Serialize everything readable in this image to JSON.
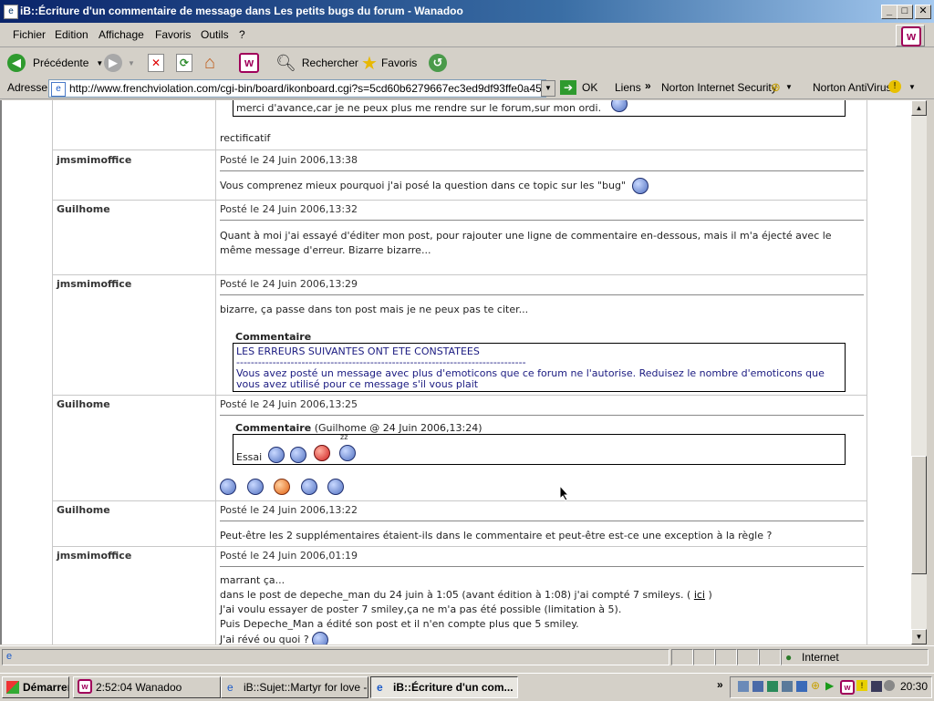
{
  "window": {
    "title": "iB::Écriture d'un commentaire de message dans Les petits bugs du forum - Wanadoo",
    "minimize": "_",
    "maximize": "□",
    "close": "✕"
  },
  "menu": [
    "Fichier",
    "Edition",
    "Affichage",
    "Favoris",
    "Outils",
    "?"
  ],
  "toolbar": {
    "back_label": "Précédente",
    "search_label": "Rechercher",
    "favorites_label": "Favoris"
  },
  "address": {
    "label": "Adresse",
    "url": "http://www.frenchviolation.com/cgi-bin/board/ikonboard.cgi?s=5cd60b6279667ec3ed9df93ffe0a458;act=P",
    "go_label": "OK",
    "links_label": "Liens",
    "nis_label": "Norton Internet Security",
    "nav_label": "Norton AntiVirus"
  },
  "posts": [
    {
      "comment_text": "merci d'avance,car je ne peux plus me rendre sur le forum,sur mon ordi.",
      "text": "rectificatif"
    },
    {
      "author": "jmsmimoffice",
      "date": "Posté le 24 Juin 2006,13:38",
      "text": "Vous comprenez mieux pourquoi j'ai posé la question dans ce topic sur les \"bug\""
    },
    {
      "author": "Guilhome",
      "date": "Posté le 24 Juin 2006,13:32",
      "text1": "Quant à moi j'ai essayé d'éditer mon post, pour rajouter une ligne de commentaire en-dessous, mais il m'a éjecté avec le",
      "text2": "même message d'erreur. Bizarre bizarre..."
    },
    {
      "author": "jmsmimoffice",
      "date": "Posté le 24 Juin 2006,13:29",
      "text": "bizarre, ça passe dans ton post mais je ne peux pas te citer...",
      "comment_label": "Commentaire",
      "err_title": "LES ERREURS SUIVANTES ONT ETE CONSTATEES",
      "err_rule": "--------------------------------------------------------------------------------",
      "err_line1": "Vous avez posté un message avec plus d'emoticons que ce forum ne l'autorise. Reduisez le nombre d'emoticons que",
      "err_line2": "vous avez utilisé pour ce message s'il vous plait"
    },
    {
      "author": "Guilhome",
      "date": "Posté le 24 Juin 2006,13:25",
      "comment_label": "Commentaire",
      "comment_meta": "(Guilhome @ 24 Juin 2006,13:24)",
      "comment_text": "Essai",
      "zz": "zz"
    },
    {
      "author": "Guilhome",
      "date": "Posté le 24 Juin 2006,13:22",
      "text": "Peut-être les 2 supplémentaires étaient-ils dans le commentaire et peut-être est-ce une exception à la règle ?"
    },
    {
      "author": "jmsmimoffice",
      "date": "Posté le 24 Juin 2006,01:19",
      "line1": "marrant ça...",
      "line2a": "dans le post de depeche_man du 24 juin à 1:05 (avant édition à 1:08) j'ai compté 7 smileys. (",
      "line2link": "ici",
      "line2b": ")",
      "line3": "J'ai voulu essayer de poster 7 smiley,ça ne m'a pas été possible (limitation à 5).",
      "line4": "Puis Depeche_Man a édité son post et il n'en compte plus que 5 smiley.",
      "line5": "J'ai révé ou quoi ?"
    }
  ],
  "status": {
    "zone": "Internet"
  },
  "taskbar": {
    "start": "Démarrer",
    "tasks": [
      "2:52:04 Wanadoo",
      "iB::Sujet::Martyr for love - ...",
      "iB::Écriture d'un com..."
    ],
    "clock": "20:30"
  }
}
